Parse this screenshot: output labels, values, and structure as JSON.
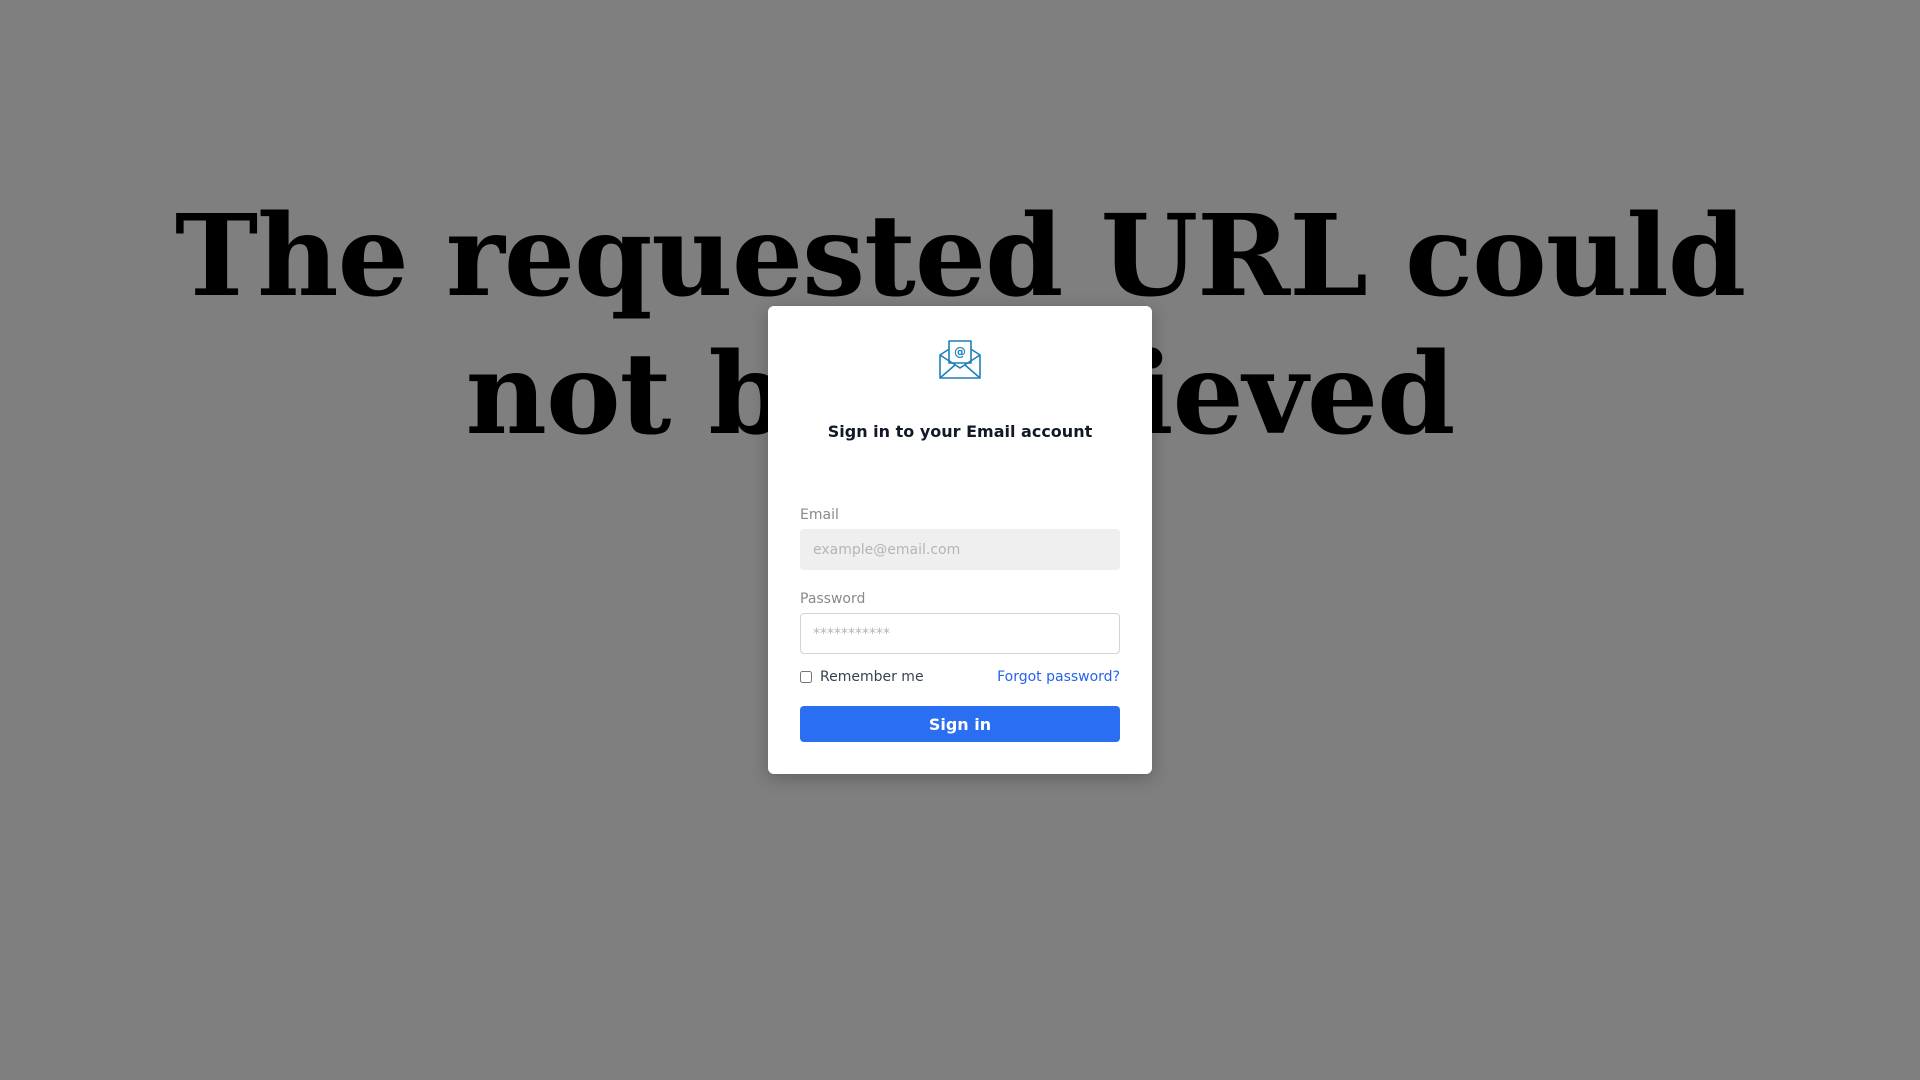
{
  "background_page": {
    "heading": "The requested URL could not be retrieved"
  },
  "login_modal": {
    "logo_icon": "envelope-at-icon",
    "title": "Sign in to your Email account",
    "email": {
      "label": "Email",
      "placeholder": "example@email.com",
      "value": ""
    },
    "password": {
      "label": "Password",
      "placeholder": "***********",
      "value": ""
    },
    "remember_me": {
      "label": "Remember me",
      "checked": false
    },
    "forgot_password_label": "Forgot password?",
    "submit_label": "Sign in"
  },
  "colors": {
    "accent": "#2a6ef2",
    "link": "#2563eb",
    "logo": "#1f7fb8",
    "overlay": "rgba(0,0,0,0.5)"
  }
}
